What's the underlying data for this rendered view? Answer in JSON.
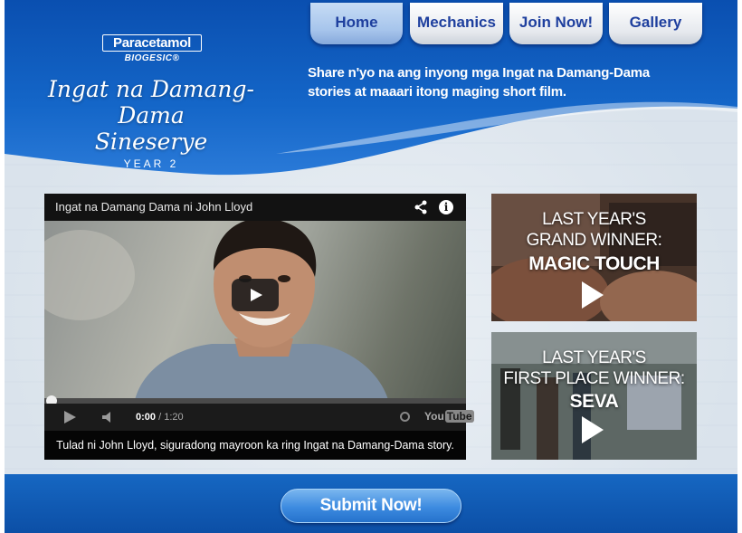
{
  "brand": {
    "line1": "Paracetamol",
    "line2": "BIOGESIC",
    "reg": "®"
  },
  "campaign": {
    "line1": "Ingat na Damang-Dama",
    "line2": "Sineserye",
    "line3": "YEAR 2"
  },
  "nav": {
    "home": "Home",
    "mechanics": "Mechanics",
    "join": "Join Now!",
    "gallery": "Gallery"
  },
  "tagline": "Share n'yo na ang inyong mga Ingat na Damang-Dama stories at maaari itong maging short film.",
  "video": {
    "title": "Ingat na Damang Dama ni John Lloyd",
    "current_time": "0:00",
    "separator": " / ",
    "duration": "1:20",
    "youtube_1": "You",
    "youtube_2": "Tube",
    "caption": "Tulad ni John Lloyd, siguradong mayroon ka ring Ingat na Damang-Dama story."
  },
  "thumbs": [
    {
      "line1": "LAST YEAR'S",
      "line2": "GRAND WINNER:",
      "line3": "MAGIC TOUCH"
    },
    {
      "line1": "LAST YEAR'S",
      "line2": "FIRST PLACE WINNER:",
      "line3": "SEVA"
    }
  ],
  "footer": {
    "submit": "Submit Now!"
  },
  "colors": {
    "header_blue": "#0d5bbf",
    "nav_text": "#1e3f9e",
    "footer_blue": "#1262bd"
  }
}
